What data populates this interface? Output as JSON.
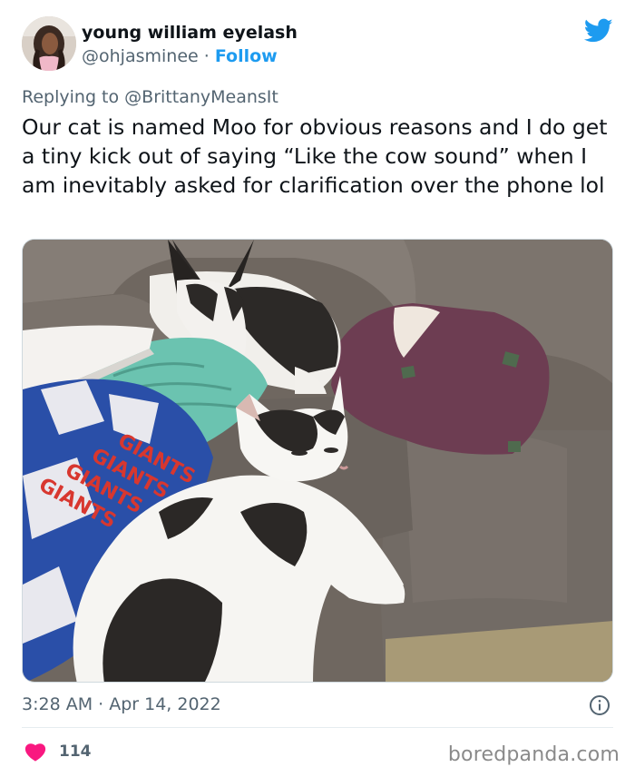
{
  "author": {
    "display_name": "young william eyelash",
    "handle": "@ohjasminee",
    "separator": "·",
    "follow_label": "Follow"
  },
  "reply": {
    "prefix": "Replying to",
    "mention": "@BrittanyMeansIt"
  },
  "tweet": {
    "text": "Our cat is named Moo for obvious reasons and I do get a tiny kick out of saying “Like the cow sound” when I am inevitably asked for clarification over the phone lol"
  },
  "blanket_text": "GIANTS",
  "meta": {
    "timestamp": "3:28 AM · Apr 14, 2022"
  },
  "engagement": {
    "likes": "114"
  },
  "watermark": "boredpanda.com",
  "colors": {
    "accent": "#1d9bf0",
    "heart": "#f91880",
    "secondary_text": "#536471"
  },
  "icons": {
    "brand": "twitter-bird-icon",
    "info": "info-icon",
    "like": "heart-icon"
  }
}
